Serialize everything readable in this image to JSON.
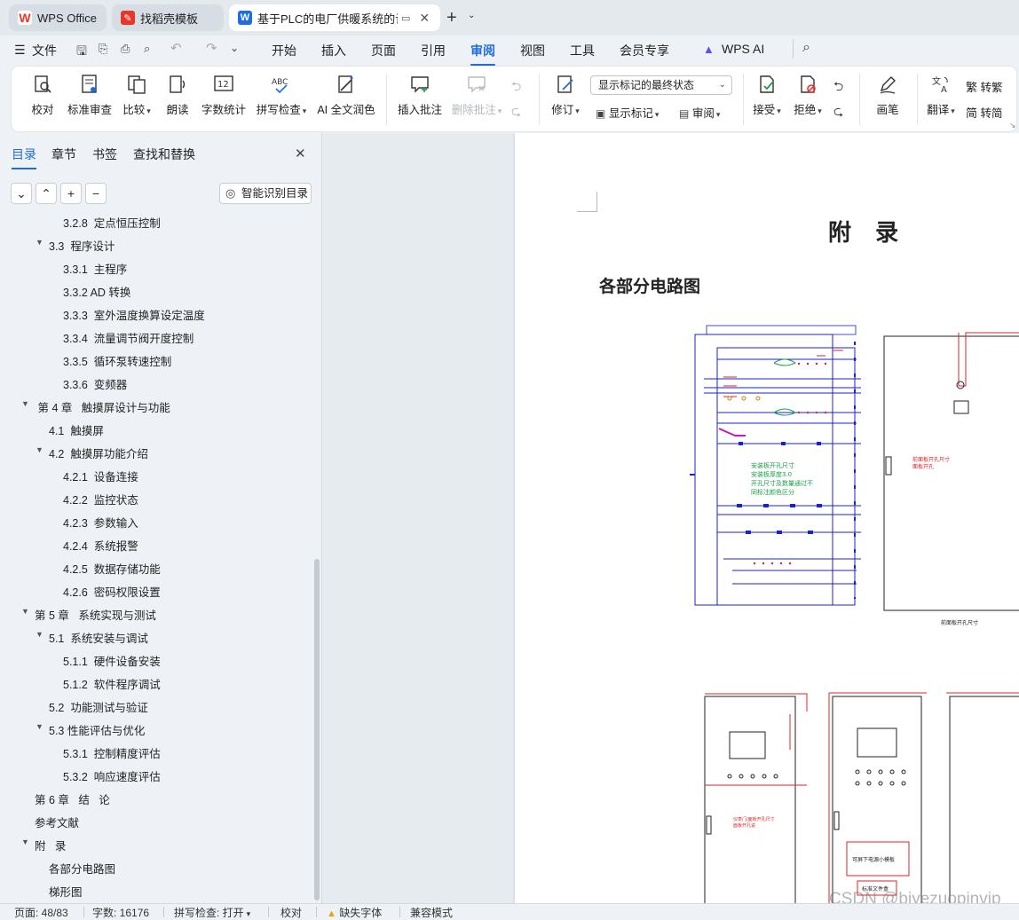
{
  "tabs": [
    {
      "label": "WPS Office"
    },
    {
      "label": "找稻壳模板"
    },
    {
      "label": "基于PLC的电厂供暖系统的设"
    }
  ],
  "menu": [
    "文件",
    "开始",
    "插入",
    "页面",
    "引用",
    "审阅",
    "视图",
    "工具",
    "会员专享",
    "WPS AI"
  ],
  "ribbon": {
    "proofread": "校对",
    "standard_review": "标准审查",
    "compare": "比较",
    "read_aloud": "朗读",
    "word_count": "字数统计",
    "spell_check": "拼写检查",
    "ai_polish": "AI 全文润色",
    "insert_comment": "插入批注",
    "delete_comment": "删除批注",
    "revise": "修订",
    "markup_select": "显示标记的最终状态",
    "show_markup": "显示标记",
    "review_pane": "审阅",
    "accept": "接受",
    "reject": "拒绝",
    "pen": "画笔",
    "translate": "翻译",
    "to_traditional": "转繁",
    "to_simplified": "转简"
  },
  "panel": {
    "tabs": [
      "目录",
      "章节",
      "书签",
      "查找和替换"
    ],
    "smart_toc": "智能识别目录",
    "toc": [
      {
        "level": 3,
        "text": "3.2.8  定点恒压控制",
        "expand": ""
      },
      {
        "level": 2,
        "text": "3.3  程序设计",
        "expand": "▼"
      },
      {
        "level": 3,
        "text": "3.3.1  主程序",
        "expand": ""
      },
      {
        "level": 3,
        "text": "3.3.2 AD 转换",
        "expand": ""
      },
      {
        "level": 3,
        "text": "3.3.3  室外温度换算设定温度",
        "expand": ""
      },
      {
        "level": 3,
        "text": "3.3.4  流量调节阀开度控制",
        "expand": ""
      },
      {
        "level": 3,
        "text": "3.3.5  循环泵转速控制",
        "expand": ""
      },
      {
        "level": 3,
        "text": "3.3.6  变频器",
        "expand": ""
      },
      {
        "level": 1,
        "text": " 第 4 章   触摸屏设计与功能",
        "expand": "▼"
      },
      {
        "level": 2,
        "text": "4.1  触摸屏",
        "expand": ""
      },
      {
        "level": 2,
        "text": "4.2  触摸屏功能介绍",
        "expand": "▼"
      },
      {
        "level": 3,
        "text": "4.2.1  设备连接",
        "expand": ""
      },
      {
        "level": 3,
        "text": "4.2.2  监控状态",
        "expand": ""
      },
      {
        "level": 3,
        "text": "4.2.3  参数输入",
        "expand": ""
      },
      {
        "level": 3,
        "text": "4.2.4  系统报警",
        "expand": ""
      },
      {
        "level": 3,
        "text": "4.2.5  数据存储功能",
        "expand": ""
      },
      {
        "level": 3,
        "text": "4.2.6  密码权限设置",
        "expand": ""
      },
      {
        "level": 1,
        "text": "第 5 章   系统实现与测试",
        "expand": "▼"
      },
      {
        "level": 2,
        "text": "5.1  系统安装与调试",
        "expand": "▼"
      },
      {
        "level": 3,
        "text": "5.1.1  硬件设备安装",
        "expand": ""
      },
      {
        "level": 3,
        "text": "5.1.2  软件程序调试",
        "expand": ""
      },
      {
        "level": 2,
        "text": "5.2  功能测试与验证",
        "expand": ""
      },
      {
        "level": 2,
        "text": "5.3 性能评估与优化",
        "expand": "▼"
      },
      {
        "level": 3,
        "text": "5.3.1  控制精度评估",
        "expand": ""
      },
      {
        "level": 3,
        "text": "5.3.2  响应速度评估",
        "expand": ""
      },
      {
        "level": 1,
        "text": "第 6 章   结   论",
        "expand": ""
      },
      {
        "level": 1,
        "text": "参考文献",
        "expand": ""
      },
      {
        "level": 1,
        "text": "附   录",
        "expand": "▼"
      },
      {
        "level": 2,
        "text": "各部分电路图",
        "expand": ""
      },
      {
        "level": 2,
        "text": "梯形图",
        "expand": ""
      }
    ]
  },
  "document": {
    "heading": "附   录",
    "subheading": "各部分电路图",
    "diagram_green_note": [
      "安装板开孔尺寸",
      "安装板厚度3.0",
      "开孔尺寸及数量通过不",
      "同标注颜色区分"
    ],
    "diagram_red_note": [
      "前面板开孔尺寸",
      "面板开孔"
    ],
    "diagram_caption": "前面板开孔尺寸",
    "diagram_red_note2": [
      "仪表门/面板开孔尺寸",
      "面板开孔说"
    ],
    "diagram_box_label": "可屏下电源小模板",
    "diagram_box_label2": "标准文件盒"
  },
  "status": {
    "page": "页面: 48/83",
    "words": "字数: 16176",
    "spell": "拼写检查: 打开",
    "proof": "校对",
    "missing_font": "缺失字体",
    "compat": "兼容模式"
  },
  "watermark": "CSDN @biyezuopinvip",
  "colors": {
    "accent": "#1d6ce0",
    "wps_red": "#e8372a",
    "diagram_blue": "#1a23c7",
    "diagram_red": "#d9262b"
  }
}
